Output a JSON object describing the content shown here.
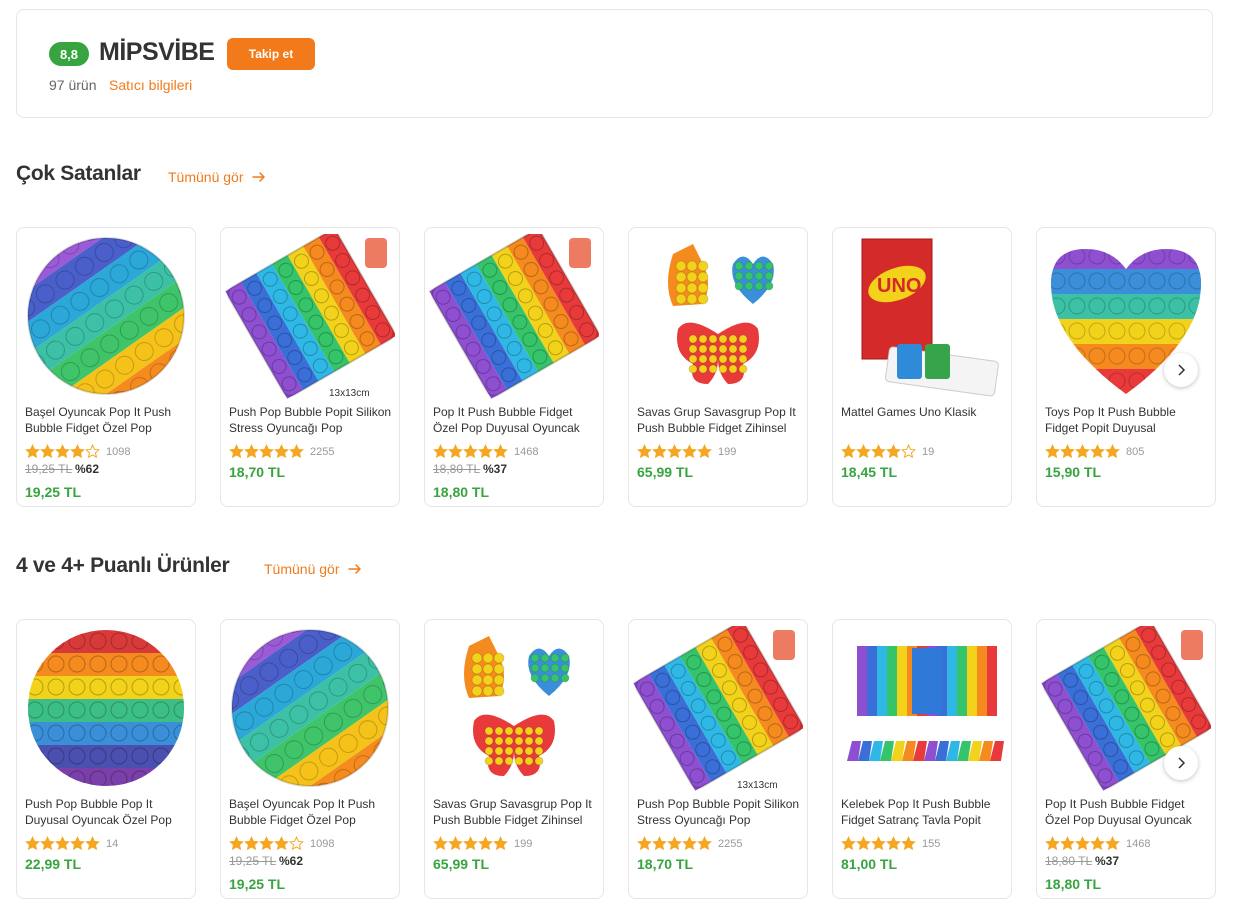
{
  "seller": {
    "score": "8,8",
    "name": "MİPSVİBE",
    "follow_label": "Takip et",
    "product_count": "97 ürün",
    "info_link": "Satıcı bilgileri"
  },
  "sections": [
    {
      "title": "Çok Satanlar",
      "see_all": "Tümünü gör",
      "products": [
        {
          "image": "round-pop-it-rainbow-diagonal",
          "name": "Başel Oyuncak Pop It Push Bubble Fidget Özel Pop",
          "stars": 4,
          "reviews": "1098",
          "old_price": "19,25 TL",
          "discount": "%62",
          "price": "19,25 TL"
        },
        {
          "image": "square-pop-it-rainbow",
          "name": "Push Pop Bubble Popit Silikon Stress Oyuncağı Pop",
          "stars": 5,
          "reviews": "2255",
          "old_price": "",
          "discount": "",
          "price": "18,70 TL",
          "caption": "13x13cm"
        },
        {
          "image": "square-pop-it-rainbow",
          "name": "Pop It Push Bubble Fidget Özel Pop Duyusal Oyuncak",
          "stars": 5,
          "reviews": "1468",
          "old_price": "18,80 TL",
          "discount": "%37",
          "price": "18,80 TL"
        },
        {
          "image": "unicorn-heart-butterfly-pop-it",
          "name": "Savas Grup Savasgrup Pop It Push Bubble Fidget Zihinsel",
          "stars": 5,
          "reviews": "199",
          "old_price": "",
          "discount": "",
          "price": "65,99 TL"
        },
        {
          "image": "uno-card-box",
          "name": "Mattel Games Uno Klasik",
          "stars": 4,
          "reviews": "19",
          "old_price": "",
          "discount": "",
          "price": "18,45 TL"
        },
        {
          "image": "heart-pop-it-rainbow",
          "name": "Toys Pop It Push Bubble Fidget Popit Duyusal",
          "stars": 5,
          "reviews": "805",
          "old_price": "",
          "discount": "",
          "price": "15,90 TL"
        }
      ]
    },
    {
      "title": "4 ve 4+ Puanlı Ürünler",
      "see_all": "Tümünü gör",
      "products": [
        {
          "image": "round-pop-it-rainbow-horizontal",
          "name": "Push Pop Bubble Pop It Duyusal Oyuncak Özel Pop",
          "stars": 5,
          "reviews": "14",
          "old_price": "",
          "discount": "",
          "price": "22,99 TL"
        },
        {
          "image": "round-pop-it-rainbow-diagonal",
          "name": "Başel Oyuncak Pop It Push Bubble Fidget Özel Pop",
          "stars": 4,
          "reviews": "1098",
          "old_price": "19,25 TL",
          "discount": "%62",
          "price": "19,25 TL"
        },
        {
          "image": "unicorn-heart-butterfly-pop-it",
          "name": "Savas Grup Savasgrup Pop It Push Bubble Fidget Zihinsel",
          "stars": 5,
          "reviews": "199",
          "old_price": "",
          "discount": "",
          "price": "65,99 TL"
        },
        {
          "image": "square-pop-it-rainbow",
          "name": "Push Pop Bubble Popit Silikon Stress Oyuncağı Pop",
          "stars": 5,
          "reviews": "2255",
          "old_price": "",
          "discount": "",
          "price": "18,70 TL",
          "caption": "13x13cm"
        },
        {
          "image": "chess-board-pop-it",
          "name": "Kelebek Pop It Push Bubble Fidget Satranç Tavla Popit",
          "stars": 5,
          "reviews": "155",
          "old_price": "",
          "discount": "",
          "price": "81,00 TL"
        },
        {
          "image": "square-pop-it-rainbow",
          "name": "Pop It Push Bubble Fidget Özel Pop Duyusal Oyuncak",
          "stars": 5,
          "reviews": "1468",
          "old_price": "18,80 TL",
          "discount": "%37",
          "price": "18,80 TL"
        }
      ]
    }
  ],
  "colors": {
    "accent": "#f27a1a",
    "price_green": "#37a440",
    "star": "#f5a623",
    "border": "#e6e6e6"
  },
  "icons": {
    "next": "chevron-right-icon",
    "see_all_arrow": "arrow-right-icon",
    "star": "star-icon"
  }
}
